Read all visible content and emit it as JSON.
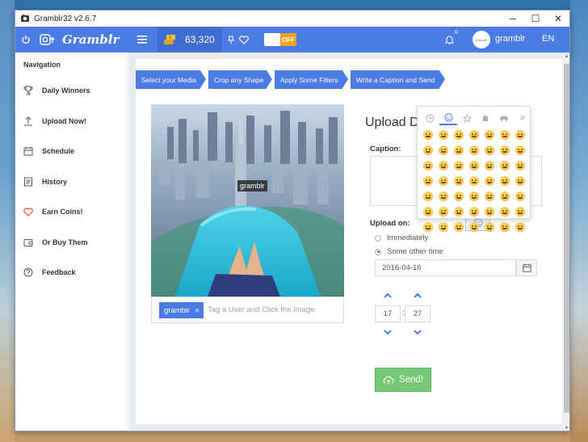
{
  "window": {
    "title": "Gramblr32 v2.6.7",
    "minimize": "─",
    "maximize": "☐",
    "close": "✕"
  },
  "header": {
    "logo": "Gramblr",
    "coins": "63,320",
    "toggle_label": "OFF",
    "notification_count": "0",
    "avatar_text": "Gramblr",
    "username": "gramblr",
    "language": "EN",
    "accent_color": "#4b7be5"
  },
  "sidebar": {
    "title": "Navigation",
    "items": [
      {
        "label": "Daily Winners",
        "icon": "trophy-icon"
      },
      {
        "label": "Upload Now!",
        "icon": "upload-icon"
      },
      {
        "label": "Schedule",
        "icon": "calendar-icon"
      },
      {
        "label": "History",
        "icon": "history-icon"
      },
      {
        "label": "Earn Coins!",
        "icon": "heart-icon"
      },
      {
        "label": "Or Buy Them",
        "icon": "wallet-icon"
      },
      {
        "label": "Feedback",
        "icon": "question-icon"
      }
    ]
  },
  "steps": [
    {
      "label": "Select your Media"
    },
    {
      "label": "Crop any Shape"
    },
    {
      "label": "Apply Some Filters"
    },
    {
      "label": "Write a Caption and Send"
    }
  ],
  "photo": {
    "tag_label": "gramblr",
    "chip_label": "gramblr",
    "chip_close": "×",
    "tag_placeholder": "Tag a User and Click the Image"
  },
  "upload": {
    "title": "Upload De",
    "caption_label": "Caption:",
    "upload_on_label": "Upload on:",
    "option_immediately": "Immediately",
    "option_other": "Some other time",
    "selected_option": "Some other time",
    "date": "2016-04-16",
    "hour": "17",
    "minute": "27",
    "colon": ":",
    "send_label": "Send!",
    "send_color": "#76c776"
  },
  "emoji_panel": {
    "tabs": [
      "clock-icon",
      "smiley-icon",
      "flower-icon",
      "bell-icon",
      "car-icon",
      "hash-icon"
    ],
    "active_tab": "smiley-icon",
    "hash_glyph": "#",
    "rows": 7,
    "cols": 7
  }
}
